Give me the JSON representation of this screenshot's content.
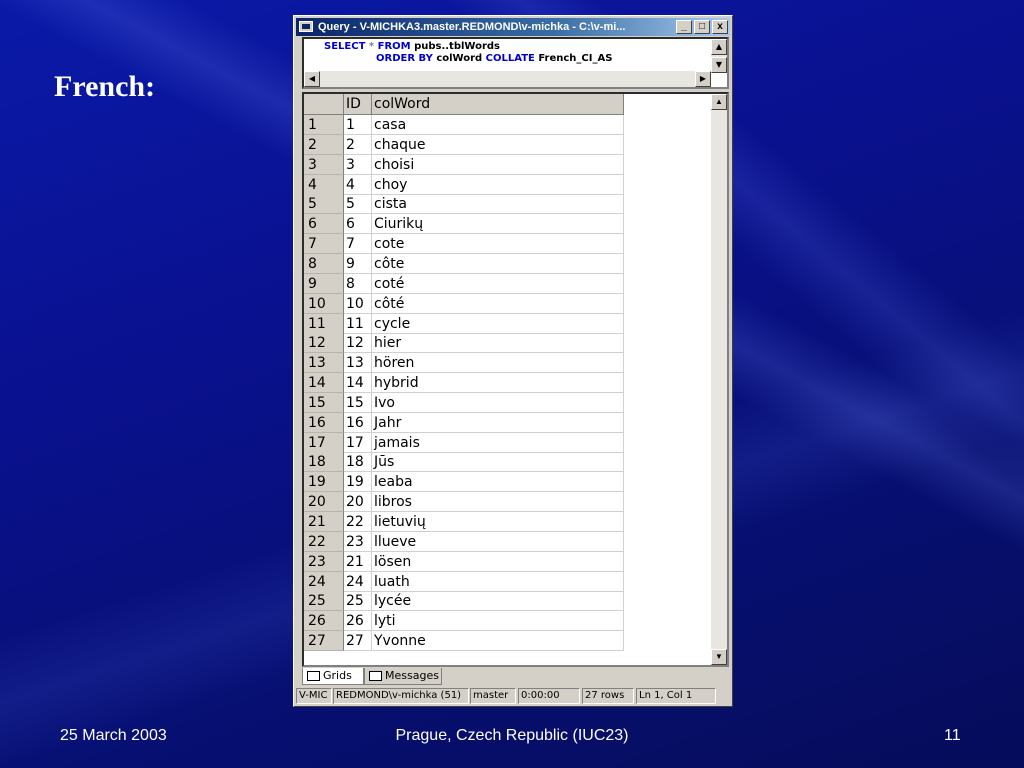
{
  "slide": {
    "title": "French:",
    "footer_date": "25 March 2003",
    "footer_center": "Prague, Czech Republic (IUC23)",
    "page_number": "11"
  },
  "window": {
    "title": "Query - V-MICHKA3.master.REDMOND\\v-michka - C:\\v-mi...",
    "min_label": "_",
    "max_label": "□",
    "close_label": "x"
  },
  "query": {
    "line1": {
      "kw1": "SELECT",
      "op": " * ",
      "kw2": "FROM",
      "rest": " pubs..tblWords"
    },
    "line2": {
      "kw1": "ORDER BY",
      "mid": " colWord ",
      "kw2": "COLLATE",
      "rest": " French_CI_AS"
    }
  },
  "grid": {
    "columns": [
      "ID",
      "colWord"
    ],
    "rows": [
      {
        "n": "1",
        "id": "1",
        "word": "casa"
      },
      {
        "n": "2",
        "id": "2",
        "word": "chaque"
      },
      {
        "n": "3",
        "id": "3",
        "word": "choisi"
      },
      {
        "n": "4",
        "id": "4",
        "word": "choy"
      },
      {
        "n": "5",
        "id": "5",
        "word": "cista"
      },
      {
        "n": "6",
        "id": "6",
        "word": "Ciurikų"
      },
      {
        "n": "7",
        "id": "7",
        "word": "cote"
      },
      {
        "n": "8",
        "id": "9",
        "word": "côte"
      },
      {
        "n": "9",
        "id": "8",
        "word": "coté"
      },
      {
        "n": "10",
        "id": "10",
        "word": "côté"
      },
      {
        "n": "11",
        "id": "11",
        "word": "cycle"
      },
      {
        "n": "12",
        "id": "12",
        "word": "hier"
      },
      {
        "n": "13",
        "id": "13",
        "word": "hören"
      },
      {
        "n": "14",
        "id": "14",
        "word": "hybrid"
      },
      {
        "n": "15",
        "id": "15",
        "word": "Ivo"
      },
      {
        "n": "16",
        "id": "16",
        "word": "Jahr"
      },
      {
        "n": "17",
        "id": "17",
        "word": "jamais"
      },
      {
        "n": "18",
        "id": "18",
        "word": "Jūs"
      },
      {
        "n": "19",
        "id": "19",
        "word": "leaba"
      },
      {
        "n": "20",
        "id": "20",
        "word": "libros"
      },
      {
        "n": "21",
        "id": "22",
        "word": "lietuvių"
      },
      {
        "n": "22",
        "id": "23",
        "word": "llueve"
      },
      {
        "n": "23",
        "id": "21",
        "word": "lösen"
      },
      {
        "n": "24",
        "id": "24",
        "word": "luath"
      },
      {
        "n": "25",
        "id": "25",
        "word": "lycée"
      },
      {
        "n": "26",
        "id": "26",
        "word": "lyti"
      },
      {
        "n": "27",
        "id": "27",
        "word": "Yvonne"
      }
    ]
  },
  "tabs": {
    "grids": "Grids",
    "messages": "Messages"
  },
  "status": {
    "server": "V-MIC",
    "user": "REDMOND\\v-michka (51)",
    "db": "master",
    "time": "0:00:00",
    "rows": "27 rows",
    "position": "Ln 1, Col 1"
  }
}
